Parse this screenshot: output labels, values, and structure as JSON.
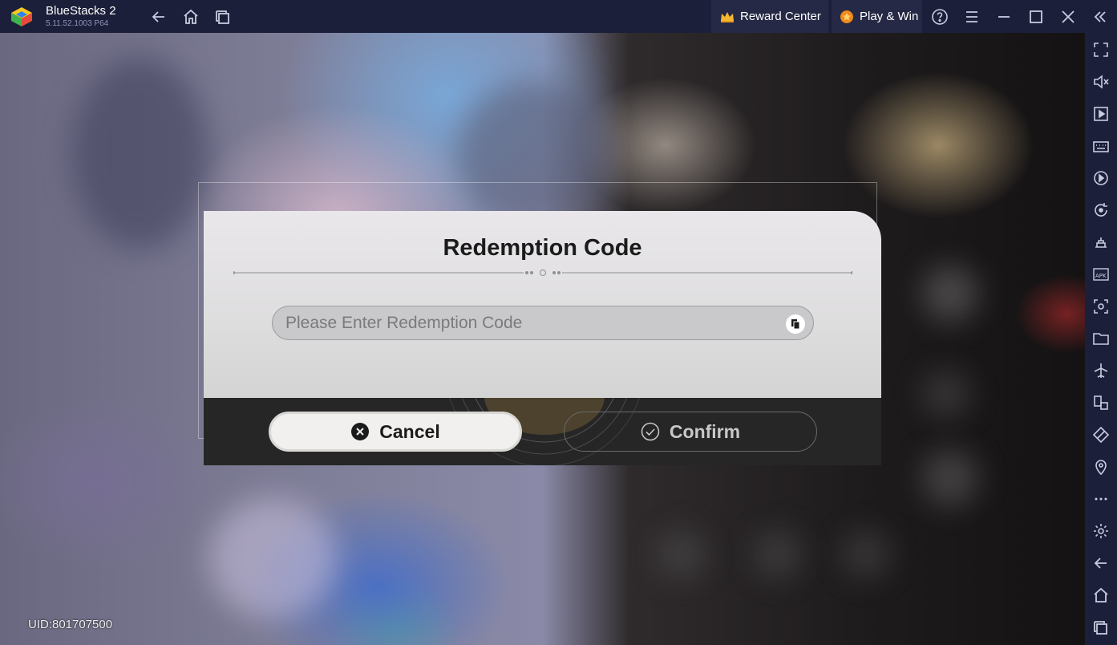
{
  "titlebar": {
    "app_name": "BlueStacks 2",
    "app_version": "5.11.52.1003  P64",
    "reward_center_label": "Reward Center",
    "play_win_label": "Play & Win"
  },
  "game": {
    "uid_text": "UID:801707500"
  },
  "dialog": {
    "title": "Redemption Code",
    "input_placeholder": "Please Enter Redemption Code",
    "input_value": "",
    "cancel_label": "Cancel",
    "confirm_label": "Confirm"
  },
  "icons": {
    "titlebar": [
      "back-icon",
      "home-icon",
      "multi-instance-icon",
      "help-icon",
      "menu-icon",
      "minimize-icon",
      "maximize-icon",
      "close-icon",
      "collapse-sidebar-icon"
    ],
    "sidebar": [
      "fullscreen-icon",
      "volume-icon",
      "media-icon",
      "keyboard-icon",
      "macro-icon",
      "sync-icon",
      "game-controls-icon",
      "install-apk-icon",
      "screenshot-icon",
      "folder-icon",
      "airplane-mode-icon",
      "multi-window-icon",
      "eco-mode-icon",
      "location-icon",
      "more-icon",
      "settings-icon",
      "back-icon",
      "home-icon",
      "recent-apps-icon"
    ]
  },
  "colors": {
    "titlebar_bg": "#1c1f3a",
    "pill_bg": "#252945",
    "dialog_bg": "#e4e3e4",
    "dialog_footer_bg": "#262626",
    "crown": "#f5b731",
    "coin": "#f08a1c"
  }
}
